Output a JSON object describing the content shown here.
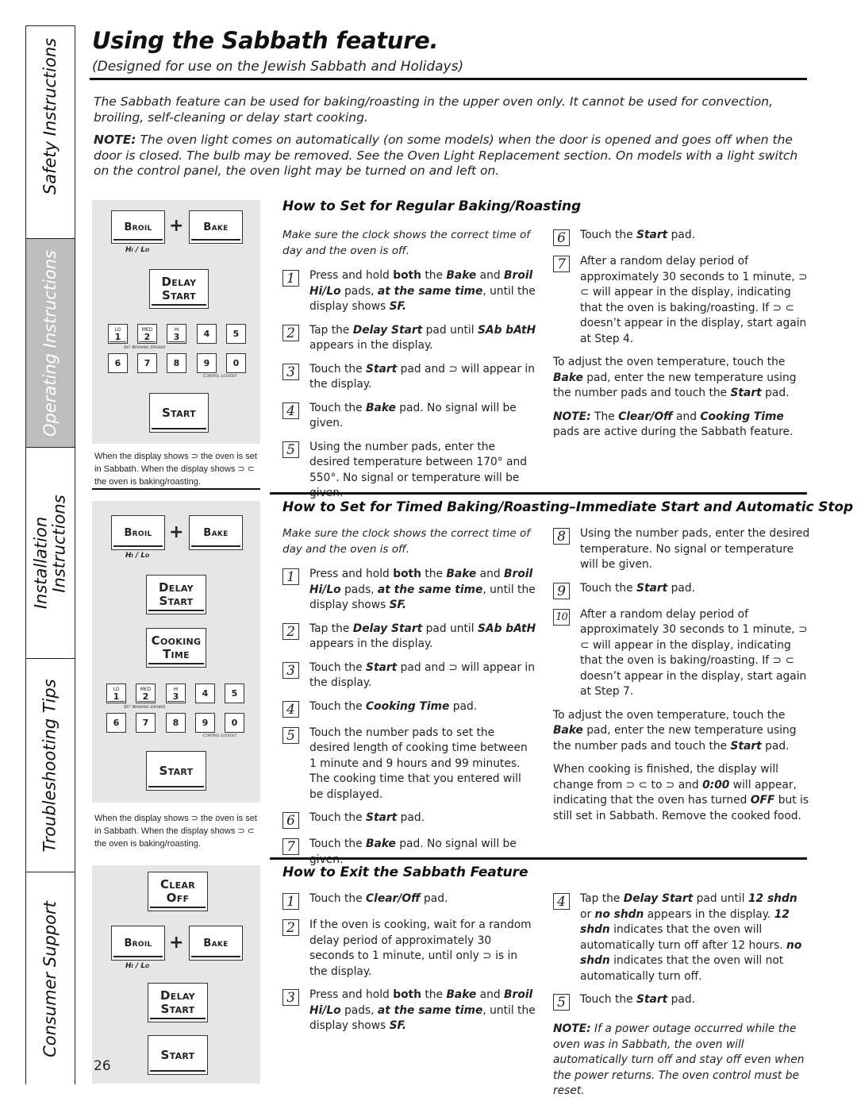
{
  "sidebar": {
    "tabs": [
      {
        "label": "Safety Instructions",
        "active": false
      },
      {
        "label": "Operating Instructions",
        "active": true
      },
      {
        "label": "Installation Instructions",
        "line1": "Installation",
        "line2": "Instructions",
        "active": false
      },
      {
        "label": "Troubleshooting Tips",
        "active": false
      },
      {
        "label": "Consumer Support",
        "active": false
      }
    ],
    "active_color": "#bdbdbd"
  },
  "header": {
    "title": "Using the Sabbath feature.",
    "subtitle": "(Designed for use on the Jewish Sabbath and Holidays)"
  },
  "intro": {
    "p1": "The Sabbath feature can be used for baking/roasting in the upper oven only. It cannot be used for convection, broiling, self-cleaning or delay start cooking.",
    "note_label": "NOTE:",
    "note_text": " The oven light comes on automatically (on some models) when the door is opened and goes off when the door is closed. The bulb may be removed. See the Oven Light Replacement section. On models with a light switch on the control panel, the oven light may be turned on and left on."
  },
  "panel_labels": {
    "broil": "Broil",
    "bake": "Bake",
    "plus": "+",
    "hilo": "Hi / Lo",
    "delay": "Delay",
    "start_word": "Start",
    "cooking": "Cooking",
    "time": "Time",
    "clear": "Clear",
    "off": "Off",
    "start": "Start",
    "warming_drawer": "Set Warming Drawer",
    "control_lockout": "Control Lockout",
    "keys_row1": [
      {
        "top": "LO",
        "num": "1"
      },
      {
        "top": "MED",
        "num": "2"
      },
      {
        "top": "HI",
        "num": "3"
      },
      {
        "top": "",
        "num": "4"
      },
      {
        "top": "",
        "num": "5"
      }
    ],
    "keys_row2": [
      "6",
      "7",
      "8",
      "9",
      "0"
    ],
    "caption": "When the display shows ⊃ the oven is set in Sabbath. When the display shows ⊃ ⊂  the oven is baking/roasting."
  },
  "regular": {
    "heading": "How to Set for Regular Baking/Roasting",
    "lead": "Make sure the clock shows the correct time of day and the oven is off.",
    "steps": [
      {
        "n": "1",
        "parts": [
          [
            "",
            "Press and hold "
          ],
          [
            "b",
            "both"
          ],
          [
            "",
            " the "
          ],
          [
            "bi",
            "Bake"
          ],
          [
            "",
            " and "
          ],
          [
            "bi",
            "Broil Hi/Lo"
          ],
          [
            "",
            " pads, "
          ],
          [
            "bi",
            "at the same time"
          ],
          [
            "",
            ", until the display shows "
          ],
          [
            "bi",
            "SF."
          ]
        ]
      },
      {
        "n": "2",
        "parts": [
          [
            "",
            "Tap the "
          ],
          [
            "bi",
            "Delay Start"
          ],
          [
            "",
            " pad until "
          ],
          [
            "bi",
            "SAb bAtH"
          ],
          [
            "",
            " appears in the display."
          ]
        ]
      },
      {
        "n": "3",
        "parts": [
          [
            "",
            "Touch the "
          ],
          [
            "bi",
            "Start"
          ],
          [
            "",
            " pad and ⊃ will appear in the display."
          ]
        ]
      },
      {
        "n": "4",
        "parts": [
          [
            "",
            "Touch the "
          ],
          [
            "bi",
            "Bake"
          ],
          [
            "",
            " pad. No signal will be given."
          ]
        ]
      },
      {
        "n": "5",
        "parts": [
          [
            "",
            "Using the number pads, enter the desired temperature between 170° and 550°. No signal or temperature will be given."
          ]
        ]
      },
      {
        "n": "6",
        "parts": [
          [
            "",
            "Touch the "
          ],
          [
            "bi",
            "Start"
          ],
          [
            "",
            " pad."
          ]
        ]
      },
      {
        "n": "7",
        "parts": [
          [
            "",
            "After a random delay period of approximately 30 seconds to 1 minute, ⊃ ⊂ will appear in the display, indicating that the oven is baking/roasting. If ⊃ ⊂  doesn’t appear in the display, start again at Step 4."
          ]
        ]
      }
    ],
    "adjust": [
      [
        "",
        "To adjust the oven temperature, touch the "
      ],
      [
        "bi",
        "Bake"
      ],
      [
        "",
        " pad, enter the new temperature using the number pads and touch the "
      ],
      [
        "bi",
        "Start"
      ],
      [
        "",
        " pad."
      ]
    ],
    "note": [
      [
        "bi",
        "NOTE:"
      ],
      [
        "",
        " The "
      ],
      [
        "bi",
        "Clear/Off"
      ],
      [
        "",
        " and "
      ],
      [
        "bi",
        "Cooking Time"
      ],
      [
        "",
        " pads are active during the Sabbath feature."
      ]
    ]
  },
  "timed": {
    "heading": "How to Set for Timed Baking/Roasting–Immediate Start and Automatic Stop",
    "lead": "Make sure the clock shows the correct time of day and the oven is off.",
    "steps": [
      {
        "n": "1",
        "parts": [
          [
            "",
            "Press and hold "
          ],
          [
            "b",
            "both"
          ],
          [
            "",
            " the "
          ],
          [
            "bi",
            "Bake"
          ],
          [
            "",
            " and "
          ],
          [
            "bi",
            "Broil Hi/Lo"
          ],
          [
            "",
            " pads, "
          ],
          [
            "bi",
            "at the same time"
          ],
          [
            "",
            ", until the display shows "
          ],
          [
            "bi",
            "SF."
          ]
        ]
      },
      {
        "n": "2",
        "parts": [
          [
            "",
            "Tap the "
          ],
          [
            "bi",
            "Delay Start"
          ],
          [
            "",
            " pad until "
          ],
          [
            "bi",
            "SAb bAtH"
          ],
          [
            "",
            " appears in the display."
          ]
        ]
      },
      {
        "n": "3",
        "parts": [
          [
            "",
            "Touch the "
          ],
          [
            "bi",
            "Start"
          ],
          [
            "",
            " pad and ⊃ will appear in the display."
          ]
        ]
      },
      {
        "n": "4",
        "parts": [
          [
            "",
            "Touch the "
          ],
          [
            "bi",
            "Cooking Time"
          ],
          [
            "",
            " pad."
          ]
        ]
      },
      {
        "n": "5",
        "parts": [
          [
            "",
            "Touch the number pads to set the desired length of cooking time between 1 minute and 9 hours and 99 minutes. The cooking time that you entered will be displayed."
          ]
        ]
      },
      {
        "n": "6",
        "parts": [
          [
            "",
            "Touch the "
          ],
          [
            "bi",
            "Start"
          ],
          [
            "",
            " pad."
          ]
        ]
      },
      {
        "n": "7",
        "parts": [
          [
            "",
            "Touch the "
          ],
          [
            "bi",
            "Bake"
          ],
          [
            "",
            " pad. No signal will be given."
          ]
        ]
      },
      {
        "n": "8",
        "parts": [
          [
            "",
            "Using the number pads, enter the desired temperature. No signal or temperature will be given."
          ]
        ]
      },
      {
        "n": "9",
        "parts": [
          [
            "",
            "Touch the "
          ],
          [
            "bi",
            "Start"
          ],
          [
            "",
            " pad."
          ]
        ]
      },
      {
        "n": "10",
        "parts": [
          [
            "",
            "After a random delay period of approximately 30 seconds to 1 minute, ⊃ ⊂ will appear in the display, indicating that the oven is baking/roasting. If ⊃ ⊂  doesn’t appear in the display, start again at Step 7."
          ]
        ]
      }
    ],
    "adjust": [
      [
        "",
        "To adjust the oven temperature, touch the "
      ],
      [
        "bi",
        "Bake"
      ],
      [
        "",
        " pad, enter the new temperature using the number pads and touch the "
      ],
      [
        "bi",
        "Start"
      ],
      [
        "",
        " pad."
      ]
    ],
    "finished": [
      [
        "",
        "When cooking is finished, the display will change from ⊃ ⊂ to ⊃ and "
      ],
      [
        "bi",
        "0:00"
      ],
      [
        "",
        " will appear, indicating that the oven has turned "
      ],
      [
        "bi",
        "OFF"
      ],
      [
        "",
        " but is still set in Sabbath. Remove the cooked food."
      ]
    ]
  },
  "exit": {
    "heading": "How to Exit the Sabbath Feature",
    "steps": [
      {
        "n": "1",
        "parts": [
          [
            "",
            "Touch the "
          ],
          [
            "bi",
            "Clear/Off"
          ],
          [
            "",
            " pad."
          ]
        ]
      },
      {
        "n": "2",
        "parts": [
          [
            "",
            "If the oven is cooking, wait for a random delay period of approximately 30 seconds to 1 minute, until only ⊃ is in the display."
          ]
        ]
      },
      {
        "n": "3",
        "parts": [
          [
            "",
            "Press and hold "
          ],
          [
            "b",
            "both"
          ],
          [
            "",
            " the "
          ],
          [
            "bi",
            "Bake"
          ],
          [
            "",
            " and "
          ],
          [
            "bi",
            "Broil Hi/Lo"
          ],
          [
            "",
            " pads, "
          ],
          [
            "bi",
            "at the same time"
          ],
          [
            "",
            ", until the display shows "
          ],
          [
            "bi",
            "SF."
          ]
        ]
      },
      {
        "n": "4",
        "parts": [
          [
            "",
            "Tap the "
          ],
          [
            "bi",
            "Delay Start"
          ],
          [
            "",
            " pad until "
          ],
          [
            "bi",
            "12 shdn"
          ],
          [
            "",
            " or "
          ],
          [
            "bi",
            "no shdn"
          ],
          [
            "",
            " appears in the display. "
          ],
          [
            "bi",
            "12 shdn"
          ],
          [
            "",
            " indicates that the oven will automatically turn off after 12 hours. "
          ],
          [
            "bi",
            "no shdn"
          ],
          [
            "",
            " indicates that the oven will not automatically turn off."
          ]
        ]
      },
      {
        "n": "5",
        "parts": [
          [
            "",
            "Touch the "
          ],
          [
            "bi",
            "Start"
          ],
          [
            "",
            " pad."
          ]
        ]
      }
    ],
    "note": [
      [
        "bi",
        "NOTE:"
      ],
      [
        "",
        " If a power outage occurred while the oven was in Sabbath, the oven will automatically turn off and stay off even when the power returns. The oven control must be reset."
      ]
    ]
  },
  "page_number": "26"
}
